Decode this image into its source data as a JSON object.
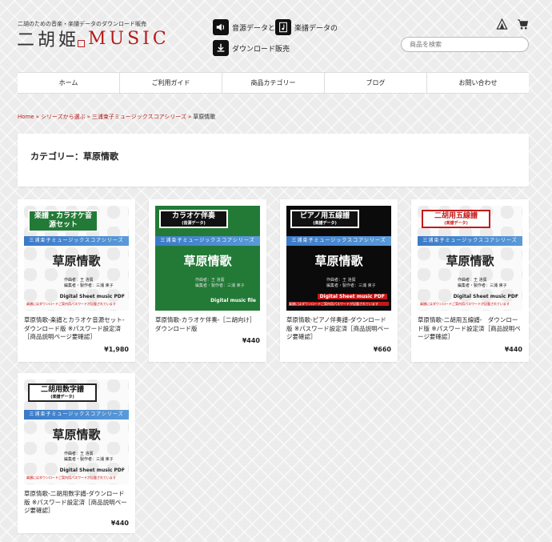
{
  "header": {
    "tagline": "二胡のための音楽・楽譜データのダウンロード販売",
    "logo_kanji": "二胡姫",
    "logo_music": "MUSIC",
    "promo_audio": "音源データと",
    "promo_score": "楽譜データの",
    "promo_download": "ダウンロード販売",
    "search_placeholder": "商品を検索"
  },
  "nav": {
    "items": [
      "ホーム",
      "ご利用ガイド",
      "商品カテゴリー",
      "ブログ",
      "お問い合わせ"
    ]
  },
  "breadcrumb": {
    "home": "Home",
    "series": "シリーズから選ぶ",
    "collection": "三浦束子ミュージックスコアシリーズ",
    "current": "草原情歌",
    "sep": "»"
  },
  "category": {
    "title": "カテゴリー：草原情歌"
  },
  "products": [
    {
      "badge": "楽譜・カラオケ音源セット",
      "badge_sub": "",
      "band": "三浦束子ミュージックスコアシリーズ",
      "thumb_title": "草原情歌",
      "credits": [
        "作曲者：王 洛賓",
        "編集者・製作者：三浦 束子"
      ],
      "foot": "Digital Sheet music PDF",
      "note": "楽譜にはダウンロードご案内用パスワードが記載されています",
      "name": "草原情歌-楽譜とカラオケ音源セット-　ダウンロード版 ※パスワード設定済［商品説明ページ要確認］",
      "price": "¥1,980"
    },
    {
      "badge": "カラオケ伴奏",
      "badge_sub": "(音源データ)",
      "band": "三浦束子ミュージックスコアシリーズ",
      "thumb_title": "草原情歌",
      "credits": [
        "作曲者：王 洛賓",
        "編集者・製作者：三浦 束子"
      ],
      "foot": "Digital music file",
      "note": "",
      "name": "草原情歌-カラオケ伴奏-［二胡向け］ダウンロード版",
      "price": "¥440"
    },
    {
      "badge": "ピアノ用五線譜",
      "badge_sub": "(楽譜データ)",
      "band": "三浦束子ミュージックスコアシリーズ",
      "thumb_title": "草原情歌",
      "credits": [
        "作曲者：王 洛賓",
        "編集者・製作者：三浦 束子"
      ],
      "foot": "Digital Sheet music PDF",
      "note": "楽譜にはダウンロードご案内用パスワードが記載されています",
      "name": "草原情歌-ピアノ伴奏譜-ダウンロード版 ※パスワード設定済［商品説明ページ要確認］",
      "price": "¥660"
    },
    {
      "badge": "二胡用五線譜",
      "badge_sub": "(楽譜データ)",
      "band": "三浦束子ミュージックスコアシリーズ",
      "thumb_title": "草原情歌",
      "credits": [
        "作曲者：王 洛賓",
        "編集者・製作者：三浦 束子"
      ],
      "foot": "Digital Sheet music PDF",
      "note": "楽譜にはダウンロードご案内用パスワードが記載されています",
      "name": "草原情歌-二胡用五線譜-　ダウンロード版 ※パスワード設定済［商品説明ページ要確認］",
      "price": "¥440"
    },
    {
      "badge": "二胡用数字譜",
      "badge_sub": "(楽譜データ)",
      "band": "三浦束子ミュージックスコアシリーズ",
      "thumb_title": "草原情歌",
      "credits": [
        "作曲者：王 洛賓",
        "編集者・製作者：三浦 束子"
      ],
      "foot": "Digital Sheet music PDF",
      "note": "楽譜にはダウンロードご案内用パスワードが記載されています",
      "name": "草原情歌-二胡用数字譜-ダウンロード版 ※パスワード設定済［商品説明ページ要確認］",
      "price": "¥440"
    }
  ],
  "colors": {
    "accent": "#b51a1a",
    "band": "#3a7ac8",
    "green_theme": "#227a36",
    "black_theme": "#0b0b0b"
  },
  "icons": {
    "promo_audio": "speaker-icon",
    "promo_score": "sheet-music-icon",
    "promo_download": "download-icon",
    "header_left": "tent-icon",
    "header_right": "cart-icon"
  }
}
